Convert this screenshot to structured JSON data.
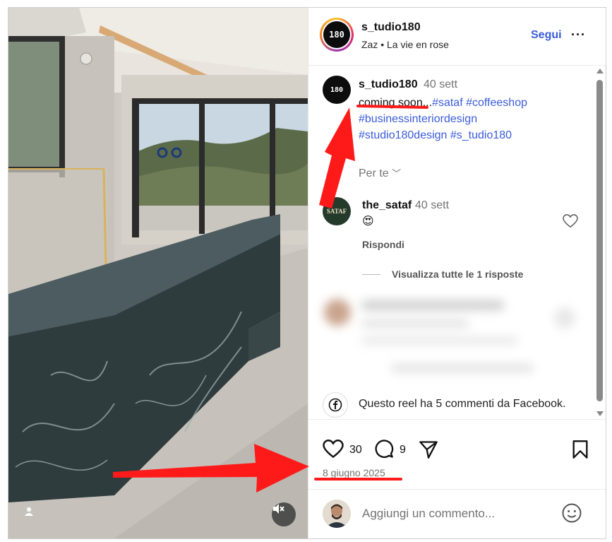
{
  "header": {
    "username": "s_tudio180",
    "subtitle": "Zaz • La vie en rose",
    "follow_label": "Segui",
    "more_label": "···",
    "logo_text": "180"
  },
  "caption": {
    "username": "s_tudio180",
    "time": "40 sett",
    "text_plain": "coming soon...",
    "hashtags_line1": "#sataf #coffeeshop",
    "hashtags_line2": "#businessinteriordesign",
    "hashtags_line3": "#studio180design #s_tudio180",
    "translate_label": "Per te",
    "translate_chevron": "﹀"
  },
  "comment": {
    "username": "the_sataf",
    "time": "40 sett",
    "emoji": "😍",
    "avatar_text": "SATAF",
    "reply_label": "Rispondi",
    "view_replies_label": "Visualizza tutte le 1 risposte"
  },
  "facebook_notice": "Questo reel ha 5 commenti da Facebook.",
  "actions": {
    "likes": "30",
    "comments": "9",
    "date": "8 giugno 2025"
  },
  "add_comment": {
    "placeholder": "Aggiungi un commento..."
  },
  "icons": {
    "like": "heart-icon",
    "comment": "comment-bubble-icon",
    "share": "paper-plane-icon",
    "save": "bookmark-icon",
    "mute": "speaker-muted-icon",
    "user": "user-tag-icon",
    "emoji": "smiley-icon",
    "facebook": "facebook-icon"
  },
  "colors": {
    "link_blue": "#3b5cd9",
    "annotation_red": "#ff1a1a"
  }
}
